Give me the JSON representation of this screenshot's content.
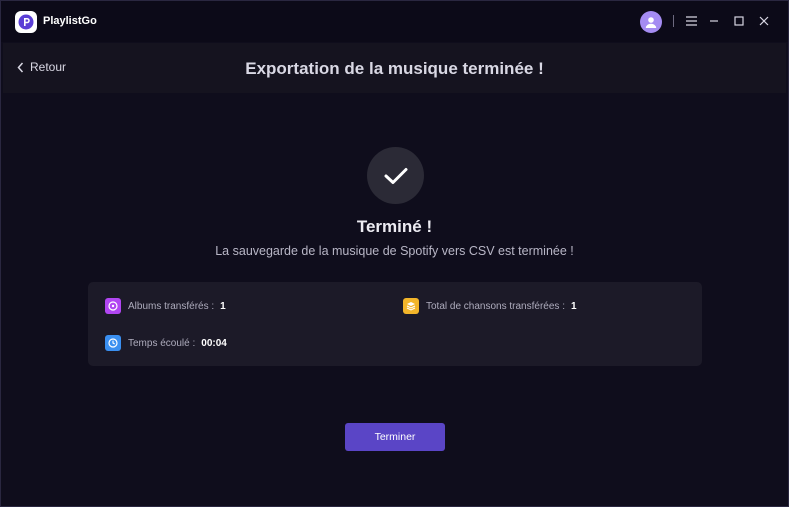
{
  "app": {
    "name": "PlaylistGo"
  },
  "nav": {
    "back_label": "Retour",
    "title": "Exportation de la musique terminée !"
  },
  "result": {
    "title": "Terminé !",
    "subtitle": "La sauvegarde de la musique de Spotify vers CSV est terminée !"
  },
  "stats": {
    "albums": {
      "label": "Albums transférés :",
      "value": "1",
      "icon": "album-icon",
      "color": "#b146f2"
    },
    "songs": {
      "label": "Total de chansons transférées :",
      "value": "1",
      "icon": "stack-icon",
      "color": "#f2b52a"
    },
    "time": {
      "label": "Temps écoulé :",
      "value": "00:04",
      "icon": "clock-icon",
      "color": "#3a8ff0"
    }
  },
  "actions": {
    "finish_label": "Terminer"
  },
  "colors": {
    "accent": "#5a45c6",
    "background": "#0f0d1c"
  }
}
